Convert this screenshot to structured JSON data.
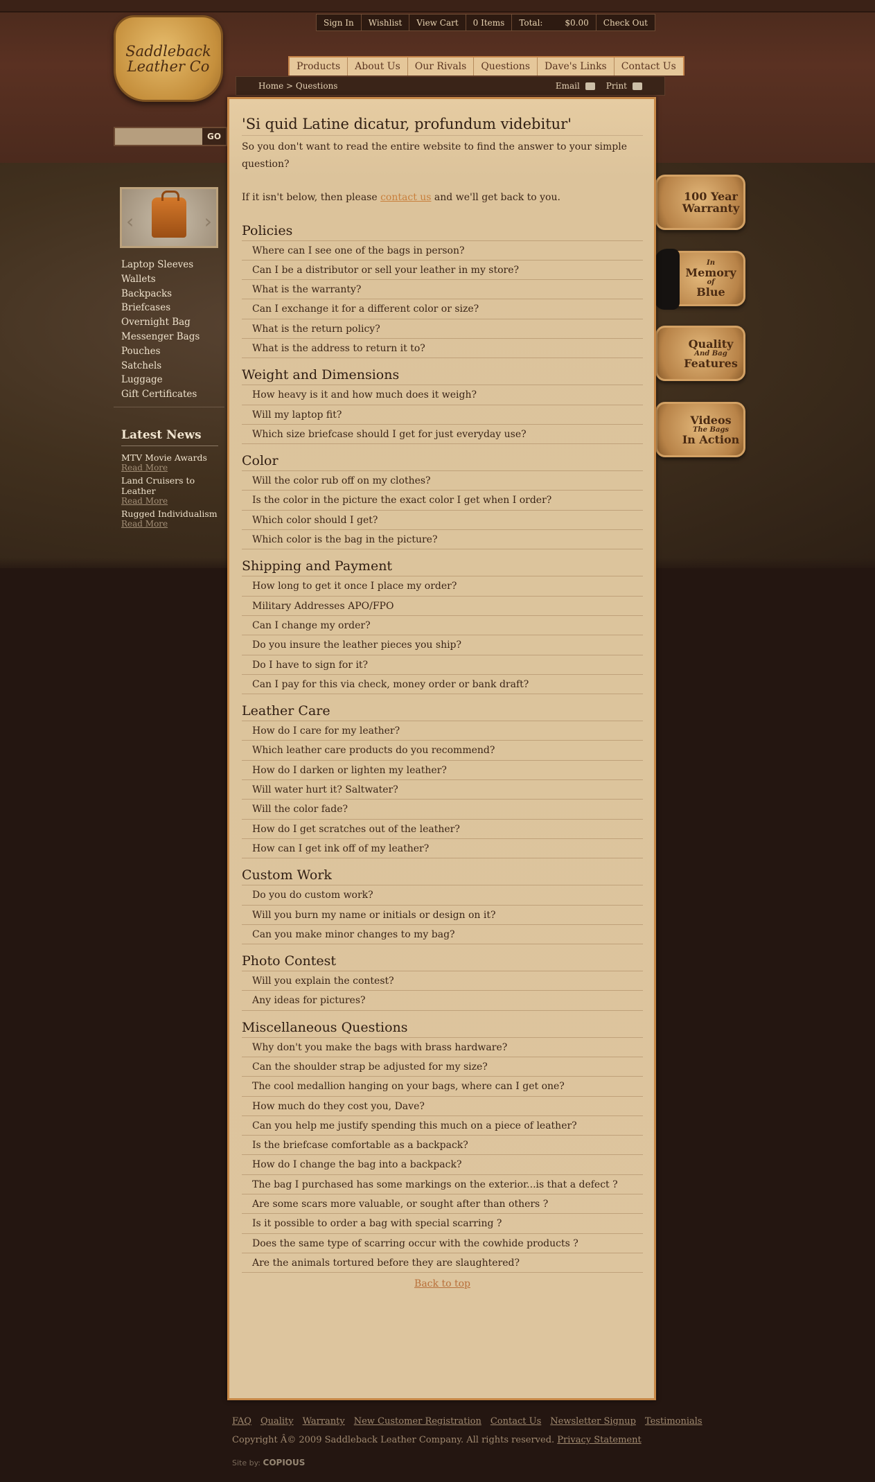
{
  "logo": {
    "line1": "Saddleback",
    "line2": "Leather Co"
  },
  "topbar": {
    "sign_in": "Sign In",
    "wishlist": "Wishlist",
    "view_cart": "View Cart",
    "items": "0 Items",
    "total_label": "Total:",
    "total_value": "$0.00",
    "checkout": "Check Out"
  },
  "nav": [
    "Products",
    "About Us",
    "Our Rivals",
    "Questions",
    "Dave's Links",
    "Contact Us"
  ],
  "breadcrumb": "Home > Questions",
  "tools": {
    "email": "Email",
    "print": "Print"
  },
  "search": {
    "button": "GO",
    "placeholder": ""
  },
  "sidebar": [
    "Laptop Sleeves",
    "Wallets",
    "Backpacks",
    "Briefcases",
    "Overnight Bag",
    "Messenger Bags",
    "Pouches",
    "Satchels",
    "Luggage",
    "Gift Certificates"
  ],
  "news": {
    "heading": "Latest News",
    "items": [
      {
        "title": "MTV Movie Awards",
        "more": "Read More"
      },
      {
        "title": "Land Cruisers to Leather",
        "more": "Read More"
      },
      {
        "title": "Rugged Individualism",
        "more": "Read More"
      }
    ]
  },
  "badges": [
    {
      "line1": "100 Year",
      "line2": "Warranty"
    },
    {
      "line1": "In",
      "line2": "Memory",
      "line3": "of",
      "line4": "Blue"
    },
    {
      "line1": "Quality",
      "line2": "And Bag",
      "line3": "Features"
    },
    {
      "line1": "Videos",
      "line2": "The Bags",
      "line3": "In Action"
    }
  ],
  "page": {
    "title": "'Si quid Latine dicatur, profundum videbitur'",
    "intro": "So you don't want to read the entire website to find the answer to your simple question?",
    "intro2_before": "If it isn't below, then please ",
    "intro2_link": "contact us",
    "intro2_after": " and we'll get back to you.",
    "back_to_top": "Back to top"
  },
  "sections": [
    {
      "title": "Policies",
      "questions": [
        "Where can I see one of the bags in person?",
        "Can I be a distributor or sell your leather in my store?",
        "What is the warranty?",
        "Can I exchange it for a different color or size?",
        "What is the return policy?",
        "What is the address to return it to?"
      ]
    },
    {
      "title": "Weight and Dimensions",
      "questions": [
        "How heavy is it and how much does it weigh?",
        "Will my laptop fit?",
        "Which size briefcase should I get for just everyday use?"
      ]
    },
    {
      "title": "Color",
      "questions": [
        "Will the color rub off on my clothes?",
        "Is the color in the picture the exact color I get when I order?",
        "Which color should I get?",
        "Which color is the bag in the picture?"
      ]
    },
    {
      "title": "Shipping and Payment",
      "questions": [
        "How long to get it once I place my order?",
        "Military Addresses APO/FPO",
        "Can I change my order?",
        "Do you insure the leather pieces you ship?",
        "Do I have to sign for it?",
        "Can I pay for this via check, money order or bank draft?"
      ]
    },
    {
      "title": "Leather Care",
      "questions": [
        "How do I care for my leather?",
        "Which leather care products do you recommend?",
        "How do I darken or lighten my leather?",
        "Will water hurt it? Saltwater?",
        "Will the color fade?",
        "How do I get scratches out of the leather?",
        "How can I get ink off of my leather?"
      ]
    },
    {
      "title": "Custom Work",
      "questions": [
        "Do you do custom work?",
        "Will you burn my name or initials or design on it?",
        "Can you make minor changes to my bag?"
      ]
    },
    {
      "title": "Photo Contest",
      "questions": [
        "Will you explain the contest?",
        "Any ideas for pictures?"
      ]
    },
    {
      "title": "Miscellaneous Questions",
      "questions": [
        "Why don't you make the bags with brass hardware?",
        "Can the shoulder strap be adjusted for my size?",
        "The cool medallion hanging on your bags, where can I get one?",
        "How much do they cost you, Dave?",
        "Can you help me justify spending this much on a piece of leather?",
        "Is the briefcase comfortable as a backpack?",
        "How do I change the bag into a backpack?",
        "The bag I purchased has some markings on the exterior...is that a defect ?",
        "Are some scars more valuable, or sought after than others ?",
        "Is it possible to order a bag with special scarring ?",
        "Does the same type of scarring occur with the cowhide products ?",
        "Are the animals tortured before they are slaughtered?"
      ]
    }
  ],
  "footer": {
    "links": [
      "FAQ",
      "Quality",
      "Warranty",
      "New Customer Registration",
      "Contact Us",
      "Newsletter Signup",
      "Testimonials"
    ],
    "copyright": "Copyright Â© 2009 Saddleback Leather Company. All rights reserved. ",
    "privacy": "Privacy Statement",
    "siteby_label": "Site by:",
    "siteby_name": "COPIOUS"
  }
}
